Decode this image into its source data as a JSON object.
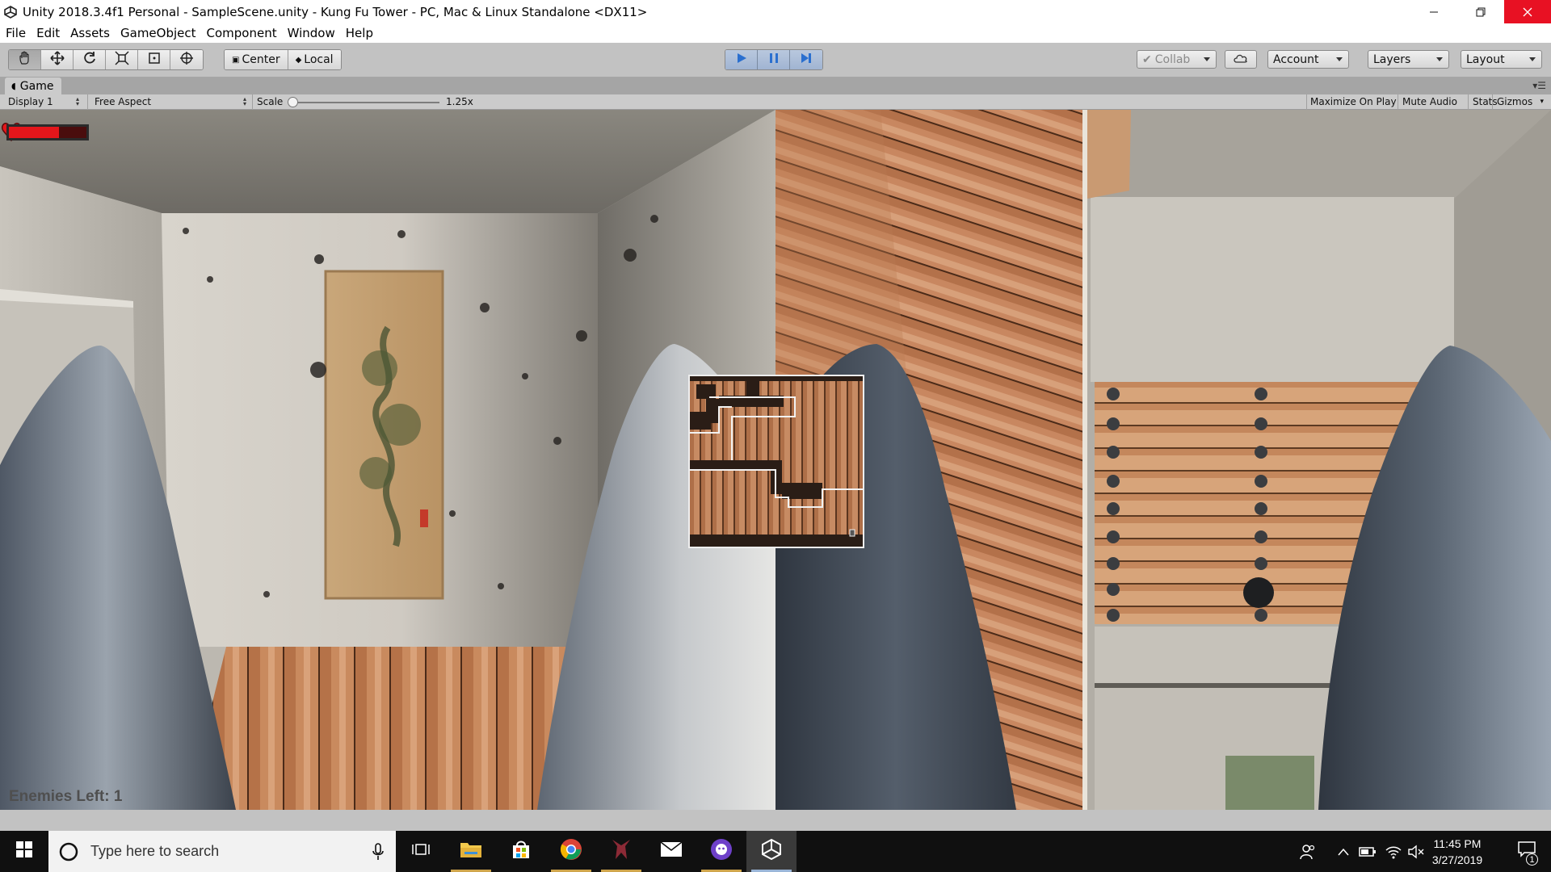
{
  "window": {
    "title": "Unity 2018.3.4f1 Personal - SampleScene.unity - Kung Fu Tower - PC, Mac & Linux Standalone <DX11>"
  },
  "menu": [
    "File",
    "Edit",
    "Assets",
    "GameObject",
    "Component",
    "Window",
    "Help"
  ],
  "toolbar": {
    "transform_tools": [
      "hand-icon",
      "move-icon",
      "rotate-icon",
      "scale-icon",
      "rect-icon",
      "transform-icon"
    ],
    "pivot_center": "Center",
    "pivot_local": "Local",
    "play_controls": [
      "play-icon",
      "pause-icon",
      "step-icon"
    ],
    "collab": "Collab",
    "account": "Account",
    "layers": "Layers",
    "layout": "Layout"
  },
  "game_tab": {
    "label": "Game"
  },
  "game_bar": {
    "display": "Display 1",
    "aspect": "Free Aspect",
    "scale_label": "Scale",
    "scale_value": "1.25x",
    "maximize": "Maximize On Play",
    "mute": "Mute Audio",
    "stats": "Stats",
    "gizmos": "Gizmos"
  },
  "hud": {
    "health_fraction": 0.65,
    "enemies_left": "Enemies Left: 1"
  },
  "taskbar": {
    "search_placeholder": "Type here to search",
    "apps": [
      "task-view-icon",
      "file-explorer-icon",
      "store-icon",
      "chrome-icon",
      "game-app-icon",
      "mail-icon",
      "github-icon",
      "unity-icon"
    ],
    "time": "11:45 PM",
    "date": "3/27/2019",
    "notifications": "1"
  },
  "colors": {
    "unity_panel": "#c2c2c2",
    "play_active": "#a0b4d2",
    "health_red": "#e4161b",
    "taskbar": "#101010"
  }
}
